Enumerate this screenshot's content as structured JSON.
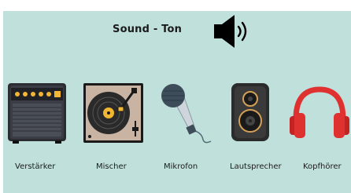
{
  "header": {
    "title": "Sound - Ton",
    "speaker_icon": "speaker-sound-icon"
  },
  "items": [
    {
      "label": "Verstärker",
      "icon": "amplifier-icon"
    },
    {
      "label": "Mischer",
      "icon": "turntable-icon"
    },
    {
      "label": "Mikrofon",
      "icon": "microphone-icon"
    },
    {
      "label": "Lautsprecher",
      "icon": "loudspeaker-icon"
    },
    {
      "label": "Kopfhörer",
      "icon": "headphones-icon"
    }
  ],
  "colors": {
    "background": "#bfe0db",
    "amp_body": "#3a3d45",
    "amp_accent": "#f2b632",
    "turntable_body": "#c9b3a3",
    "mic_head": "#3d4e5a",
    "headphones": "#e03131"
  }
}
